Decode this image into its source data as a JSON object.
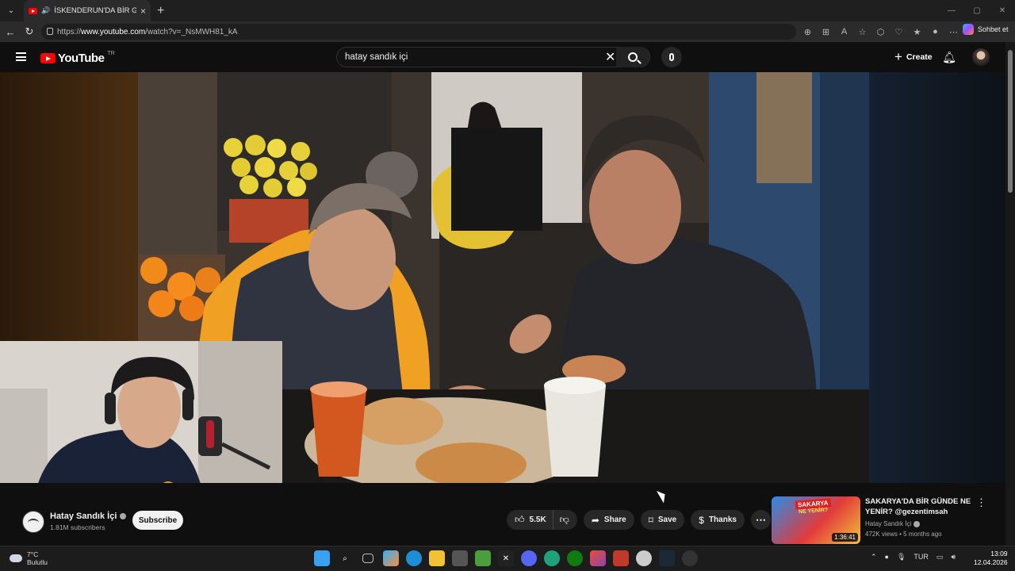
{
  "browser": {
    "tab_title": "İSKENDERUN'DA BİR GÜNDE",
    "url_prefix": "https://",
    "url_domain": "www.youtube.com",
    "url_path": "/watch?v=_NsMWH81_kA",
    "copilot_label": "Sohbet et"
  },
  "youtube": {
    "logo_text": "YouTube",
    "country_code": "TR",
    "search_query": "hatay sandık içi",
    "create_label": "Create"
  },
  "channel": {
    "name": "Hatay Sandık İçi",
    "subscribers": "1.81M subscribers",
    "subscribe_label": "Subscribe"
  },
  "actions": {
    "likes": "5.5K",
    "share_label": "Share",
    "save_label": "Save",
    "thanks_label": "Thanks"
  },
  "recommended": {
    "title": "SAKARYA'DA BİR GÜNDE NE YENİR? @gezentimsah",
    "channel": "Hatay Sandık İçi",
    "meta": "472K views • 5 months ago",
    "duration": "1:36:41",
    "thumb_text_1": "SAKARYA",
    "thumb_text_2": "NE YENİR?"
  },
  "taskbar": {
    "temperature": "7°C",
    "weather": "Bulutlu",
    "lang": "TUR",
    "time": "13:09",
    "date": "12.04.2026"
  }
}
